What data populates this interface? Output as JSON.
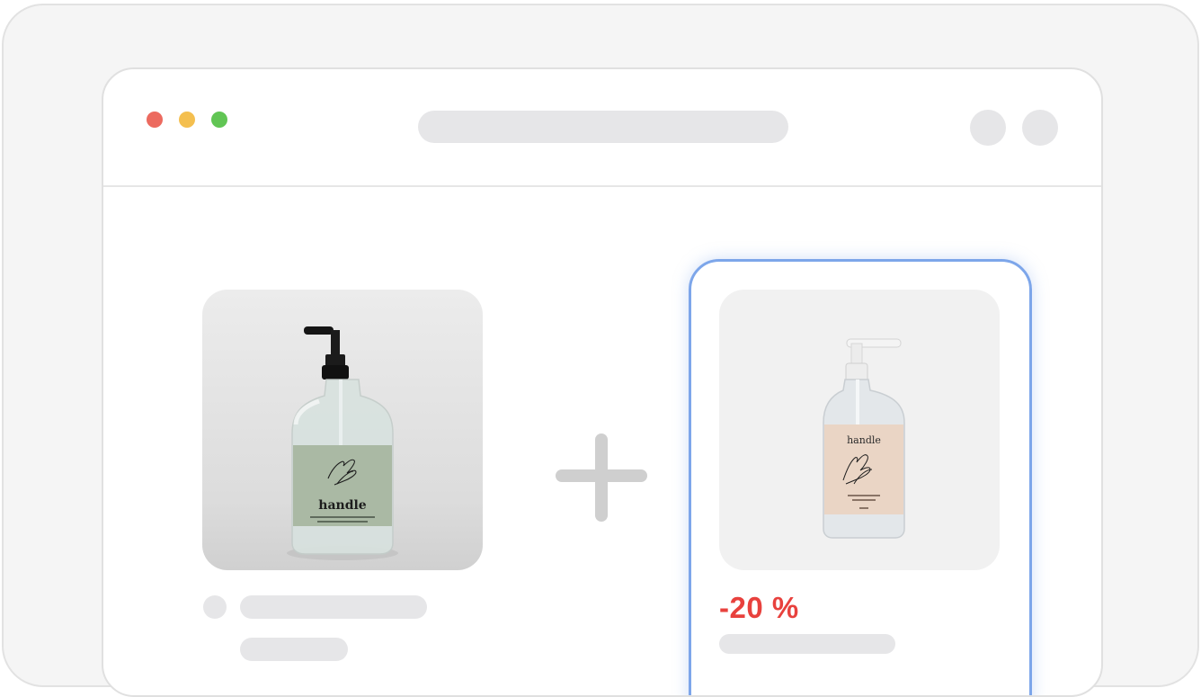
{
  "window": {
    "controls": [
      "close",
      "minimize",
      "maximize"
    ],
    "colors": {
      "close": "#ec6a5f",
      "minimize": "#f4bf4f",
      "maximize": "#61c554"
    }
  },
  "products": [
    {
      "brand": "handle",
      "label_color": "#aab9a4",
      "image": "soap-bottle-green-label"
    },
    {
      "brand": "handle",
      "label_color": "#ead5c5",
      "image": "soap-bottle-peach-label",
      "badge": "-20 %",
      "highlighted": true
    }
  ],
  "combine_symbol": "plus-icon",
  "colors": {
    "accent": "#7da6ea",
    "discount": "#e8413d",
    "skeleton": "#e6e6e8"
  }
}
